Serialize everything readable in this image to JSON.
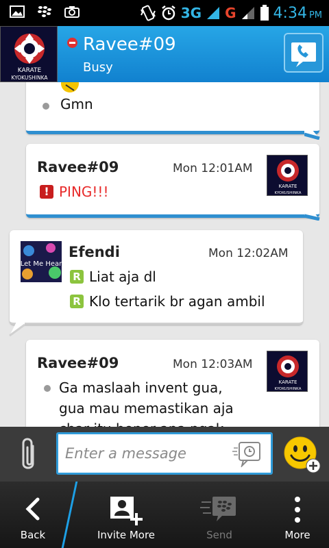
{
  "status_bar": {
    "network_3g": "3G",
    "network_3g_small": "3G",
    "network_g": "G",
    "sim_index": "2",
    "time": "4:34",
    "ampm": "PM"
  },
  "header": {
    "contact_name": "Ravee#09",
    "status": "Busy",
    "avatar_text": "KARATE",
    "avatar_text2": "KYOKUSHINKA"
  },
  "messages": [
    {
      "sender": "",
      "time": "",
      "lines": [
        "Gmn"
      ],
      "type": "mine"
    },
    {
      "sender": "Ravee#09",
      "time": "Mon 12:01AM",
      "lines": [
        "PING!!!"
      ],
      "type": "mine-ping"
    },
    {
      "sender": "Efendi",
      "time": "Mon 12:02AM",
      "lines": [
        "Liat aja dl",
        "Klo tertarik br agan ambil"
      ],
      "type": "theirs",
      "avatar_text": "Let Me Hear"
    },
    {
      "sender": "Ravee#09",
      "time": "Mon 12:03AM",
      "lines": [
        "Ga maslaah invent gua,",
        "gua mau memastikan aja",
        "char itu bener apa ngak"
      ],
      "type": "mine"
    }
  ],
  "compose": {
    "placeholder": "Enter a message"
  },
  "bottom_nav": {
    "back": "Back",
    "invite": "Invite More",
    "send": "Send",
    "more": "More"
  },
  "colors": {
    "header_blue": "#1a8fd8",
    "ping_red": "#e82a2a",
    "r_green": "#8cc43e",
    "accent": "#33b5e5"
  }
}
